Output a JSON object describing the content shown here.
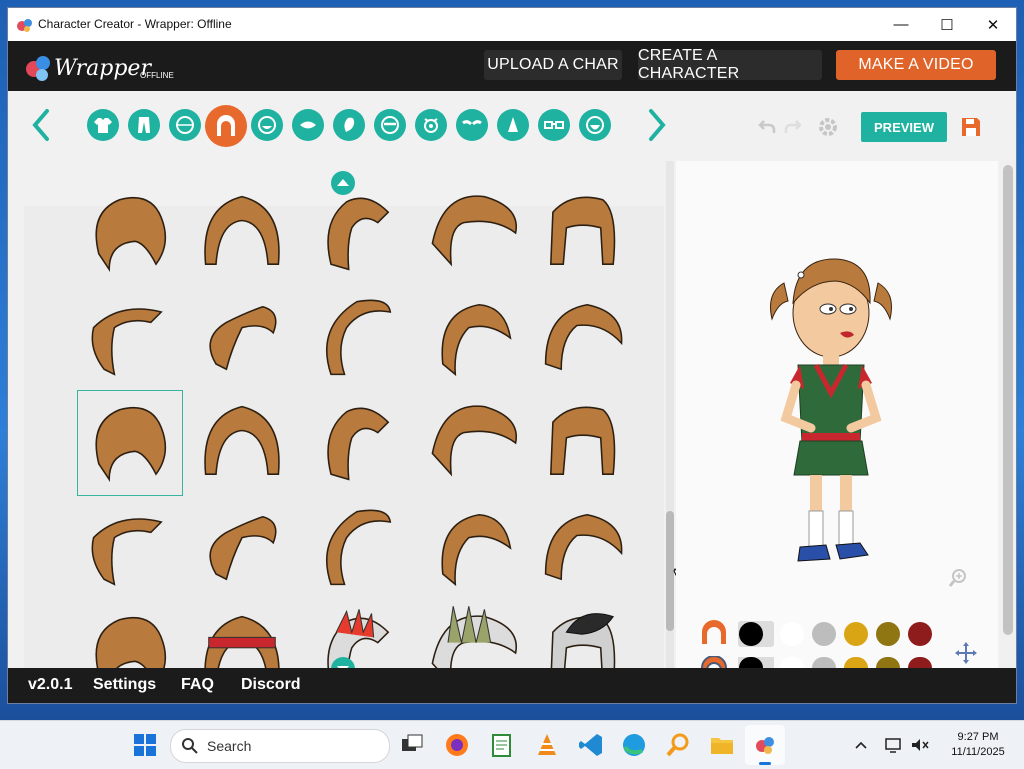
{
  "window": {
    "title": "Character Creator - Wrapper: Offline",
    "min": "—",
    "max": "☐",
    "close": "✕"
  },
  "header": {
    "logo_text": "Wrapper",
    "logo_sub": "OFFLINE",
    "upload_label": "UPLOAD A CHAR",
    "create_label": "CREATE A CHARACTER",
    "video_label": "MAKE A VIDEO"
  },
  "toolbar": {
    "categories": [
      "shirt-icon",
      "pants-icon",
      "head-icon",
      "hair-icon",
      "face-icon",
      "mouth-icon",
      "ear-icon",
      "eyebrow-icon",
      "eye-icon",
      "glasses-shape-icon",
      "nose-icon",
      "goggles-icon",
      "beard-icon"
    ],
    "active_category": "hair-icon",
    "preview_label": "PREVIEW"
  },
  "colors": {
    "accent_teal": "#20b2a1",
    "accent_orange": "#e8692c",
    "hair_brown": "#b87a3d",
    "swatches": [
      "#000000",
      "#ffffff",
      "#bdbdbd",
      "#d9a514",
      "#8f7613",
      "#8f1c1c"
    ]
  },
  "footer": {
    "version": "v2.0.1",
    "settings": "Settings",
    "faq": "FAQ",
    "discord": "Discord"
  },
  "taskbar": {
    "search_placeholder": "Search",
    "time": "9:27 PM",
    "date": "11/11/2025"
  }
}
